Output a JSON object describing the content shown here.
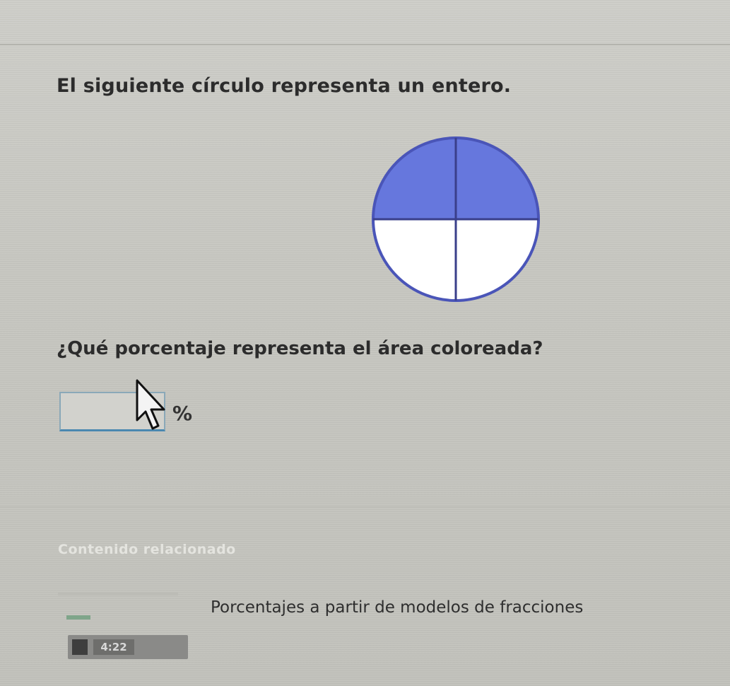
{
  "exercise": {
    "prompt": "El siguiente círculo representa un entero.",
    "question": "¿Qué porcentaje representa el área coloreada?",
    "answer_value": "",
    "answer_placeholder": "",
    "unit_symbol": "%"
  },
  "fraction_model": {
    "total_parts": 4,
    "shaded_parts": 2,
    "shaded_color": "#6677dd",
    "outline_color": "#4a55b8",
    "unshaded_color": "#ffffff"
  },
  "related": {
    "title": "Contenido relacionado",
    "items": [
      {
        "label": "Porcentajes a partir de modelos de fracciones",
        "icon": "video-icon",
        "duration": "4:22"
      }
    ]
  },
  "colors": {
    "background": "#c9c9c4",
    "text": "#2c2c2c",
    "input_border": "#4a88b0"
  }
}
